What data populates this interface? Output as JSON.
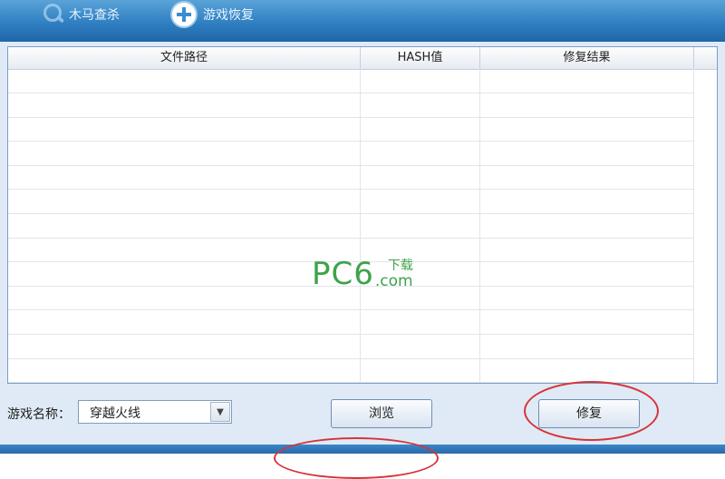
{
  "toolbar": {
    "trojan_scan_label": "木马查杀",
    "game_restore_label": "游戏恢复"
  },
  "table": {
    "columns": [
      "文件路径",
      "HASH值",
      "修复结果"
    ],
    "rows": []
  },
  "watermark": {
    "main": "PC6",
    "top": "下载",
    "bottom": ".com"
  },
  "footer": {
    "game_name_label": "游戏名称：",
    "game_name_value": "穿越火线",
    "browse_label": "浏览",
    "repair_label": "修复"
  },
  "colors": {
    "accent": "#2f7fc2",
    "annotation": "#d6343a",
    "watermark": "#3da34a"
  }
}
